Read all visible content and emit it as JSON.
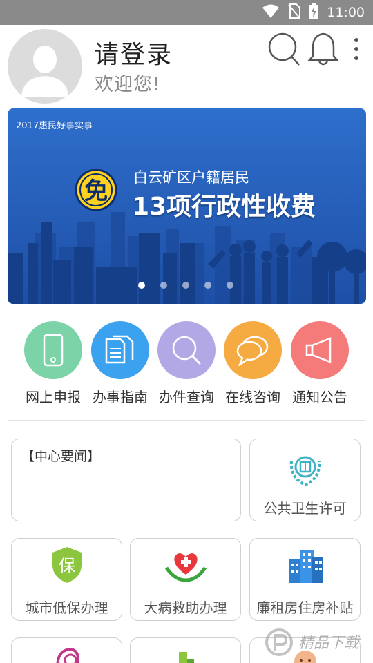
{
  "status_bar": {
    "time": "11:00",
    "icons": [
      "wifi-icon",
      "no-sim-icon",
      "battery-charging-icon"
    ]
  },
  "header": {
    "title": "请登录",
    "subtitle": "欢迎您!",
    "icons": [
      "search-icon",
      "bell-icon",
      "more-vert-icon"
    ]
  },
  "banner": {
    "tag": "2017惠民好事实事",
    "badge": "免",
    "line1": "白云矿区户籍居民",
    "line2": "13项行政性收费",
    "slides": 5,
    "active_slide": 0
  },
  "quick_menu": [
    {
      "label": "网上申报",
      "icon": "phone-icon",
      "color": "#7dd3a8"
    },
    {
      "label": "办事指南",
      "icon": "documents-icon",
      "color": "#3aa2ee"
    },
    {
      "label": "办件查询",
      "icon": "search-icon",
      "color": "#b3a8e6"
    },
    {
      "label": "在线咨询",
      "icon": "chat-icon",
      "color": "#f5ab42"
    },
    {
      "label": "通知公告",
      "icon": "megaphone-icon",
      "color": "#f57a7a"
    }
  ],
  "news": {
    "title": "【中心要闻】"
  },
  "services": [
    {
      "label": "公共卫生许可",
      "icon": "health-emblem-icon"
    },
    {
      "label": "城市低保办理",
      "icon": "shield-bao-icon",
      "badge_text": "保"
    },
    {
      "label": "大病救助办理",
      "icon": "heart-hands-icon"
    },
    {
      "label": "廉租房住房补贴",
      "icon": "buildings-icon"
    }
  ],
  "watermark": {
    "text": "精品下载"
  },
  "colors": {
    "status_bar": "#8a8a8a",
    "banner": "#2e6fcc",
    "badge_yellow": "#ffd21f"
  }
}
